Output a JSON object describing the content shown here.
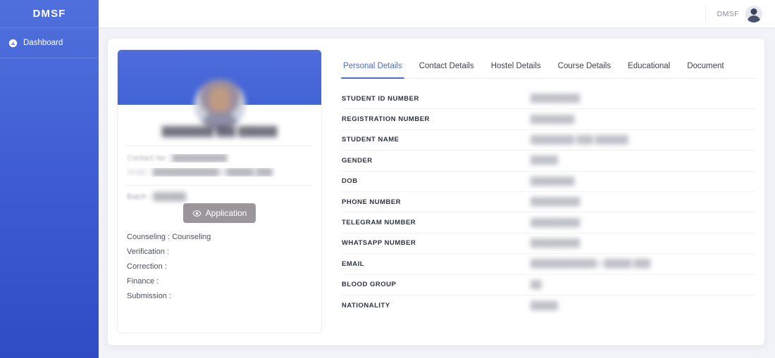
{
  "sidebar": {
    "brand": "DMSF",
    "items": [
      {
        "label": "Dashboard",
        "icon": "dashboard-gauge-icon"
      }
    ]
  },
  "topbar": {
    "user_name": "DMSF",
    "avatar_icon": "user-avatar-icon"
  },
  "profile": {
    "name": "████████ ███ ██████",
    "contact_label": "Contact No :",
    "contact_value": "██████████",
    "email_label": "Email :",
    "email_value": "████████████@█████.███",
    "batch_label": "Batch :",
    "batch_value": "██████",
    "application_button": "Application",
    "application_icon": "eye-icon",
    "statuses": [
      "Counseling : Counseling",
      "Verification :",
      "Correction :",
      "Finance :",
      "Submission :"
    ]
  },
  "details": {
    "tabs": [
      {
        "label": "Personal Details",
        "active": true
      },
      {
        "label": "Contact Details",
        "active": false
      },
      {
        "label": "Hostel Details",
        "active": false
      },
      {
        "label": "Course Details",
        "active": false
      },
      {
        "label": "Educational",
        "active": false
      },
      {
        "label": "Document",
        "active": false
      }
    ],
    "fields": [
      {
        "label": "STUDENT ID NUMBER",
        "value": "█████████"
      },
      {
        "label": "REGISTRATION NUMBER",
        "value": "████████"
      },
      {
        "label": "STUDENT NAME",
        "value": "████████ ███ ██████"
      },
      {
        "label": "GENDER",
        "value": "█████"
      },
      {
        "label": "DOB",
        "value": "████████"
      },
      {
        "label": "PHONE NUMBER",
        "value": "█████████"
      },
      {
        "label": "TELEGRAM NUMBER",
        "value": "█████████"
      },
      {
        "label": "WHATSAPP NUMBER",
        "value": "█████████"
      },
      {
        "label": "EMAIL",
        "value": "████████████@█████.███"
      },
      {
        "label": "BLOOD GROUP",
        "value": "██"
      },
      {
        "label": "NATIONALITY",
        "value": "█████"
      }
    ]
  },
  "colors": {
    "brand_blue": "#4a6bd8",
    "sidebar_top": "#4f6fdc",
    "sidebar_bottom": "#2f4cc4",
    "banner_blue": "#4164d6",
    "page_bg": "#f2f3f8",
    "button_gray": "#9b9699"
  }
}
